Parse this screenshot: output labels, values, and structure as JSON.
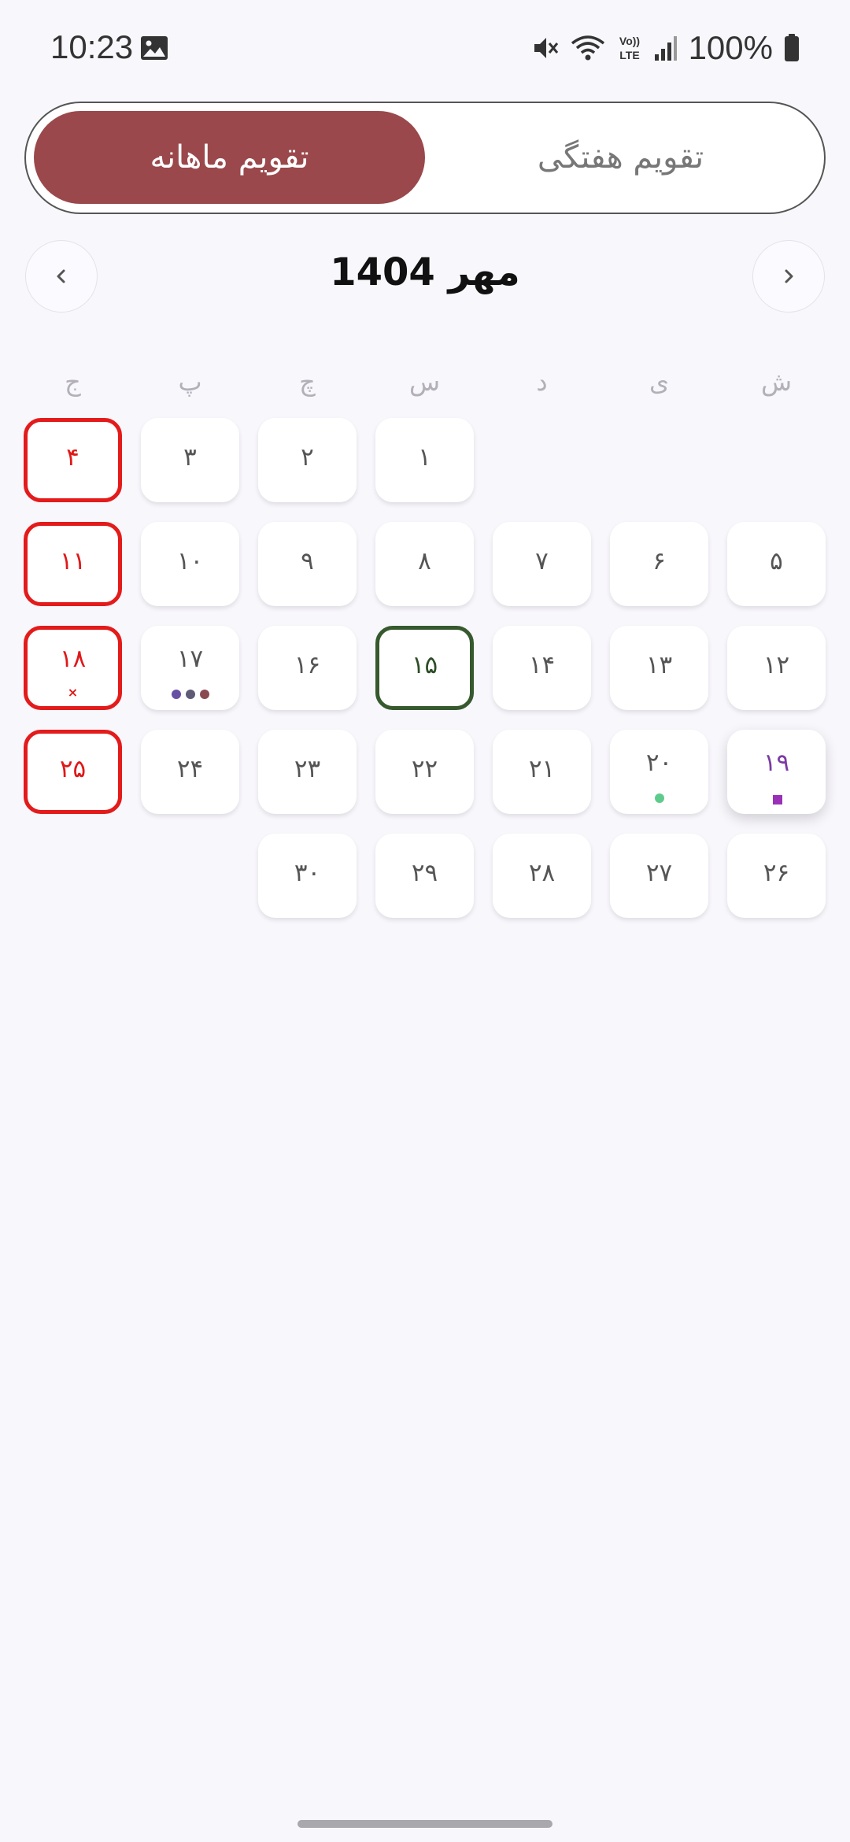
{
  "status_bar": {
    "time": "10:23",
    "battery": "100%",
    "icons": [
      "gallery-icon",
      "mute-icon",
      "wifi-icon",
      "volte-icon",
      "signal-icon",
      "battery-icon"
    ]
  },
  "toggle": {
    "monthly_label": "تقویم ماهانه",
    "weekly_label": "تقویم هفتگی",
    "selected": "monthly",
    "active_color": "#9a484b"
  },
  "month_nav": {
    "title": "مهر 1404",
    "prev_icon": "chevron-left-icon",
    "next_icon": "chevron-right-icon"
  },
  "weekdays": [
    "ش",
    "ی",
    "د",
    "س",
    "چ",
    "پ",
    "ج"
  ],
  "colors": {
    "friday_border": "#e31b1b",
    "today_border": "#36592e",
    "highlight_text": "#7b3aa3"
  },
  "weeks": [
    [
      null,
      null,
      null,
      {
        "label": "۱"
      },
      {
        "label": "۲"
      },
      {
        "label": "۳"
      },
      {
        "label": "۴",
        "friday": true
      }
    ],
    [
      {
        "label": "۵"
      },
      {
        "label": "۶"
      },
      {
        "label": "۷"
      },
      {
        "label": "۸"
      },
      {
        "label": "۹"
      },
      {
        "label": "۱۰"
      },
      {
        "label": "۱۱",
        "friday": true
      }
    ],
    [
      {
        "label": "۱۲"
      },
      {
        "label": "۱۳"
      },
      {
        "label": "۱۴"
      },
      {
        "label": "۱۵",
        "today": true
      },
      {
        "label": "۱۶"
      },
      {
        "label": "۱۷",
        "dots": [
          "#6750a4",
          "#5f5a75",
          "#8a4a52"
        ]
      },
      {
        "label": "۱۸",
        "friday": true,
        "mark": "×"
      }
    ],
    [
      {
        "label": "۱۹",
        "highlight": true,
        "square": "#9b30b8"
      },
      {
        "label": "۲۰",
        "dots": [
          "#5ecb8c"
        ]
      },
      {
        "label": "۲۱"
      },
      {
        "label": "۲۲"
      },
      {
        "label": "۲۳"
      },
      {
        "label": "۲۴"
      },
      {
        "label": "۲۵",
        "friday": true
      }
    ],
    [
      {
        "label": "۲۶"
      },
      {
        "label": "۲۷"
      },
      {
        "label": "۲۸"
      },
      {
        "label": "۲۹"
      },
      {
        "label": "۳۰"
      },
      null,
      null
    ]
  ]
}
